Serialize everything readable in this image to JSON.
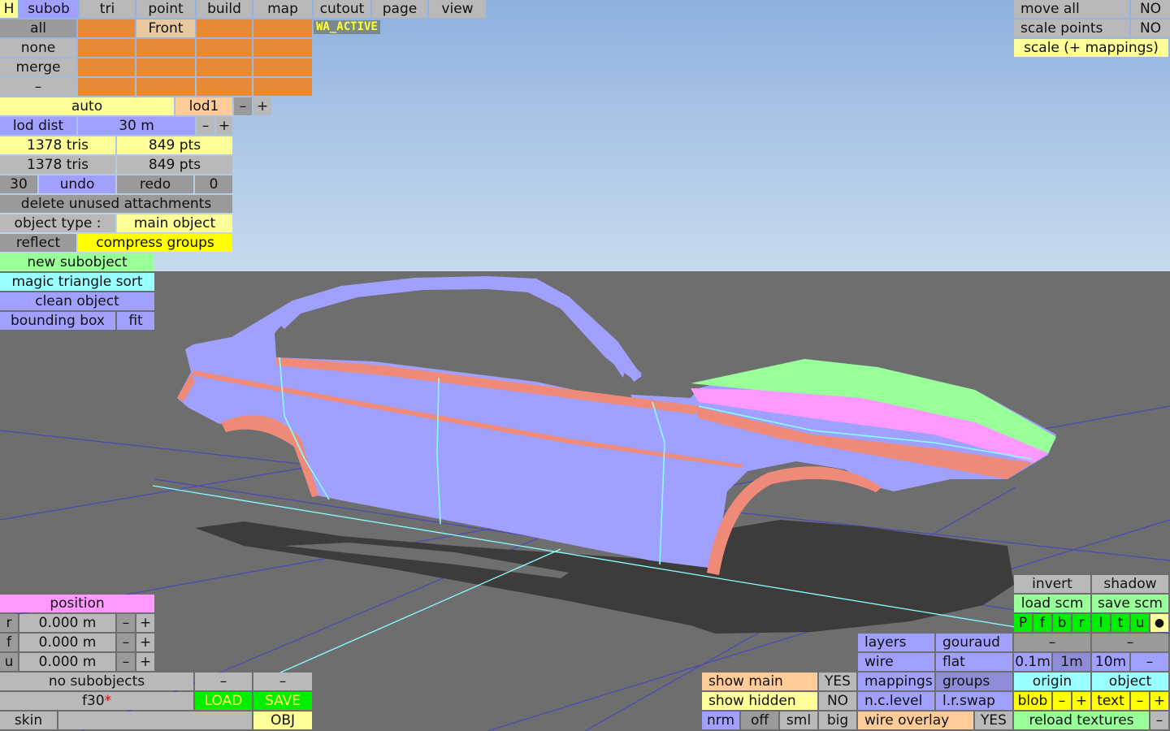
{
  "menu": {
    "h": "H",
    "items": [
      "subob",
      "tri",
      "point",
      "build",
      "map",
      "cutout",
      "page",
      "view"
    ]
  },
  "selection": {
    "all": "all",
    "none": "none",
    "merge": "merge",
    "dash": "–",
    "front": "Front"
  },
  "badge": "WA_ACTIVE",
  "lod": {
    "auto": "auto",
    "name": "lod1",
    "minus": "–",
    "plus": "+",
    "dist_label": "lod dist",
    "dist_value": "30 m"
  },
  "stats": {
    "tris_1": "1378 tris",
    "pts_1": "849 pts",
    "tris_2": "1378 tris",
    "pts_2": "849 pts"
  },
  "history": {
    "count": "30",
    "undo": "undo",
    "redo": "redo",
    "redo_count": "0"
  },
  "actions": {
    "delete_unused": "delete unused attachments",
    "object_type_label": "object type :",
    "object_type_value": "main object",
    "reflect": "reflect",
    "compress_groups": "compress groups",
    "new_subobject": "new subobject",
    "magic_sort": "magic triangle sort",
    "clean_object": "clean object",
    "bounding_box": "bounding box",
    "fit": "fit"
  },
  "top_right": {
    "move_all": "move all",
    "move_all_value": "NO",
    "scale_points": "scale points",
    "scale_points_value": "NO",
    "scale_mappings": "scale (+ mappings)"
  },
  "position": {
    "title": "position",
    "rows": [
      {
        "axis": "r",
        "value": "0.000 m"
      },
      {
        "axis": "f",
        "value": "0.000 m"
      },
      {
        "axis": "u",
        "value": "0.000 m"
      }
    ],
    "minus": "–",
    "plus": "+"
  },
  "bottom_left": {
    "no_subobjects": "no subobjects",
    "dash": "–",
    "file": "f30",
    "file_marker": "*",
    "load": "LOAD",
    "save": "SAVE",
    "skin": "skin",
    "obj": "OBJ"
  },
  "display": {
    "show_main": "show main",
    "show_main_value": "YES",
    "show_hidden": "show hidden",
    "show_hidden_value": "NO",
    "nrm": "nrm",
    "off": "off",
    "sml": "sml",
    "big": "big"
  },
  "render": {
    "layers": "layers",
    "gouraud": "gouraud",
    "wire": "wire",
    "flat": "flat",
    "mappings": "mappings",
    "groups": "groups",
    "nc_level": "n.c.level",
    "lr_swap": "l.r.swap",
    "wire_overlay": "wire overlay",
    "wire_overlay_value": "YES"
  },
  "scm": {
    "invert": "invert",
    "shadow": "shadow",
    "load_scm": "load scm",
    "save_scm": "save scm",
    "flags": [
      "P",
      "f",
      "b",
      "r",
      "l",
      "t",
      "u"
    ],
    "dot": "●",
    "dash": "–",
    "grid": [
      "0.1m",
      "1m",
      "10m"
    ],
    "origin": "origin",
    "object": "object",
    "blob": "blob",
    "text": "text",
    "minus": "–",
    "plus": "+",
    "reload_textures": "reload textures"
  },
  "colors": {
    "sky_top": "#8fb1df",
    "sky_bottom": "#c5d9ee",
    "ground": "#6e6e6e",
    "body": "#a0a0ff",
    "trim": "#f08a78",
    "hood_green": "#99ff99",
    "hood_pink": "#ff99ff",
    "shadow": "#3e3b3b",
    "edge_line": "#88ffff"
  }
}
